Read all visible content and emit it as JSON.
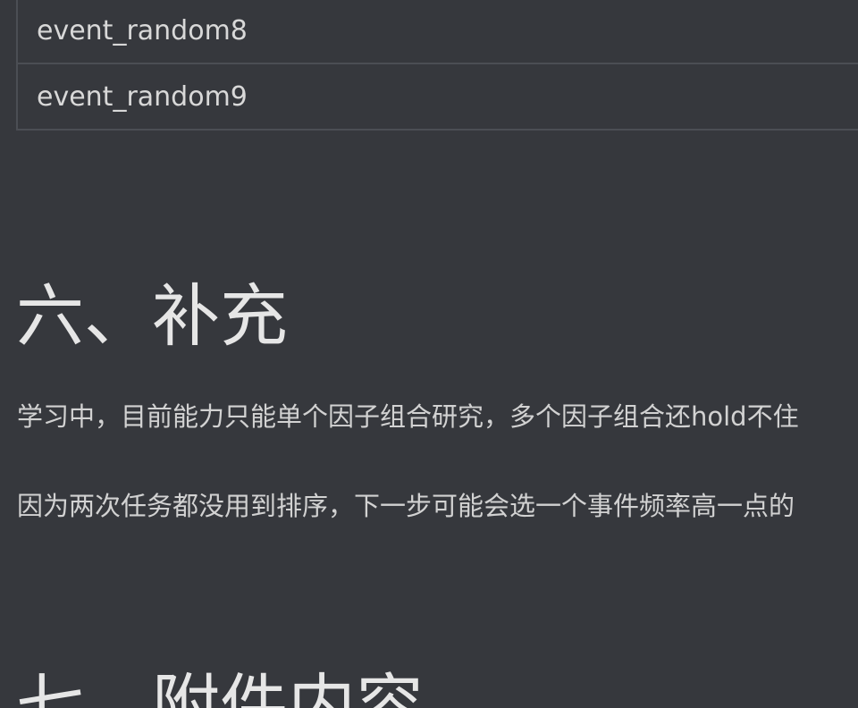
{
  "table": {
    "rows": [
      {
        "value": "event_random8"
      },
      {
        "value": "event_random9"
      }
    ]
  },
  "section6": {
    "heading": "六、补充",
    "paragraphs": [
      "学习中，目前能力只能单个因子组合研究，多个因子组合还hold不住",
      "因为两次任务都没用到排序，下一步可能会选一个事件频率高一点的"
    ]
  },
  "section7": {
    "heading": "七、附件内容"
  }
}
